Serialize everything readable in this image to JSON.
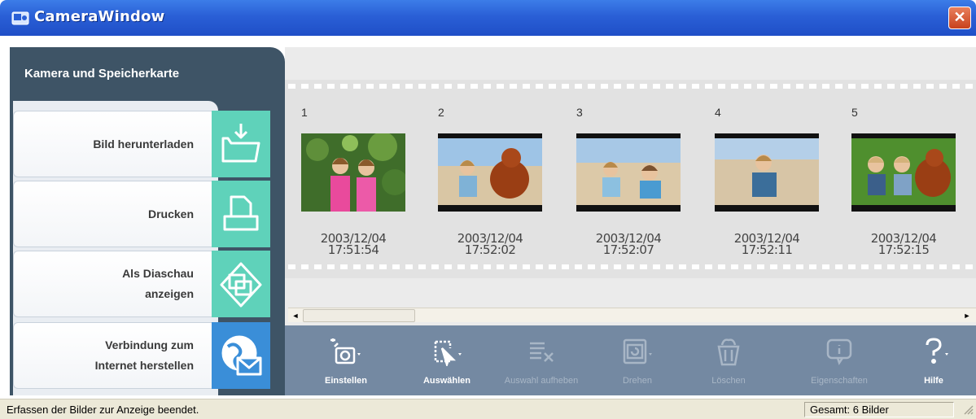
{
  "window": {
    "title": "CameraWindow",
    "close_glyph": "✕"
  },
  "left_panel": {
    "title": "Kamera und Speicherkarte",
    "items": [
      {
        "lines": [
          "Bild herunterladen"
        ],
        "icon": "folder-download-icon"
      },
      {
        "lines": [
          "Drucken"
        ],
        "icon": "print-icon"
      },
      {
        "lines": [
          "Als Diaschau",
          "anzeigen"
        ],
        "icon": "slideshow-icon"
      },
      {
        "lines": [
          "Verbindung zum",
          "Internet herstellen"
        ],
        "icon": "globe-mail-icon"
      }
    ]
  },
  "filmstrip": {
    "frames": [
      {
        "number": "1",
        "date": "2003/12/04",
        "time": "17:51:54"
      },
      {
        "number": "2",
        "date": "2003/12/04",
        "time": "17:52:02"
      },
      {
        "number": "3",
        "date": "2003/12/04",
        "time": "17:52:07"
      },
      {
        "number": "4",
        "date": "2003/12/04",
        "time": "17:52:11"
      },
      {
        "number": "5",
        "date": "2003/12/04",
        "time": "17:52:15"
      }
    ]
  },
  "scrollbar": {
    "left_arrow": "◄",
    "right_arrow": "►"
  },
  "toolbar": {
    "tools": [
      {
        "label": "Einstellen",
        "icon": "camera-settings-icon",
        "enabled": true
      },
      {
        "label": "Auswählen",
        "icon": "select-icon",
        "enabled": true
      },
      {
        "label": "Auswahl aufheben",
        "icon": "deselect-icon",
        "enabled": false
      },
      {
        "label": "Drehen",
        "icon": "rotate-icon",
        "enabled": false
      },
      {
        "label": "Löschen",
        "icon": "delete-icon",
        "enabled": false
      },
      {
        "label": "Eigenschaften",
        "icon": "properties-icon",
        "enabled": false
      },
      {
        "label": "Hilfe",
        "icon": "help-icon",
        "enabled": true
      }
    ]
  },
  "statusbar": {
    "message": "Erfassen der Bilder zur Anzeige beendet.",
    "count": "Gesamt: 6 Bilder"
  },
  "colors": {
    "titlebar": "#2a5fd6",
    "panel_dark": "#3e5466",
    "tile_green": "#5fd2ba",
    "tile_blue": "#3a8ed8",
    "toolbar": "#7489a2"
  }
}
